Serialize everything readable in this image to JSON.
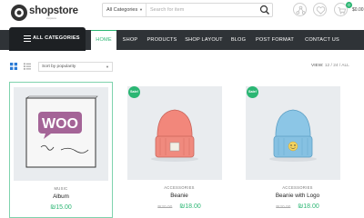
{
  "brand": {
    "name": "shopstore",
    "tagline": "shopstore"
  },
  "search": {
    "category": "All Categories",
    "placeholder": "Search for item"
  },
  "cart": {
    "count": "0",
    "total": "$0.00"
  },
  "nav": {
    "all_categories": "ALL CATEGORIES",
    "items": [
      "HOME",
      "SHOP",
      "PRODUCTS",
      "SHOP LAYOUT",
      "BLOG",
      "POST FORMAT",
      "CONTACT US"
    ],
    "active": "HOME"
  },
  "toolbar": {
    "sort": "Sort by popularity",
    "view_label": "VIEW:",
    "view_options": "12 / 24 / ALL"
  },
  "products": [
    {
      "category": "MUSIC",
      "name": "Album",
      "price": "₪15.00",
      "old_price": "",
      "sale": ""
    },
    {
      "category": "ACCESSORIES",
      "name": "Beanie",
      "price": "₪18.00",
      "old_price": "₪20.00",
      "sale": "Sale!"
    },
    {
      "category": "ACCESSORIES",
      "name": "Beanie with Logo",
      "price": "₪18.00",
      "old_price": "₪20.00",
      "sale": "Sale!"
    }
  ],
  "colors": {
    "accent": "#2bb673",
    "navbar": "#2f3337",
    "navbar_dark": "#1d2023",
    "thumb_bg": "#e9ecef"
  },
  "icons": [
    "logo-mark-icon",
    "search-icon",
    "compare-icon",
    "heart-icon",
    "cart-icon",
    "hamburger-icon",
    "grid-view-icon",
    "list-view-icon"
  ]
}
